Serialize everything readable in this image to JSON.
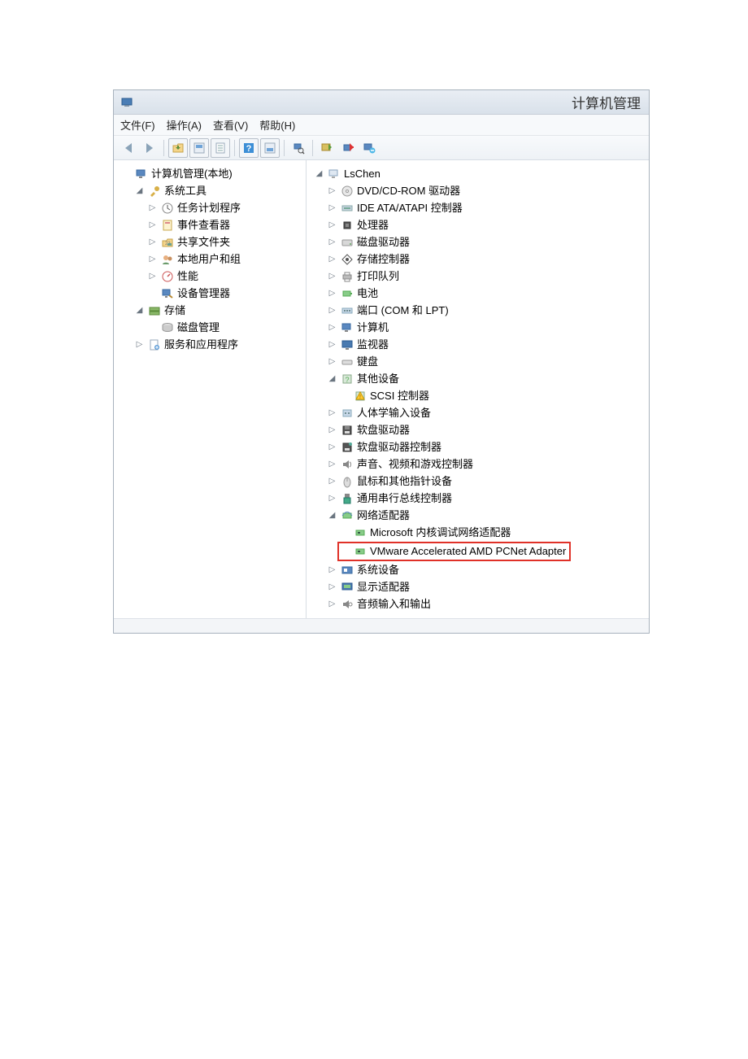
{
  "window": {
    "title": "计算机管理"
  },
  "menu": {
    "file": "文件(F)",
    "action": "操作(A)",
    "view": "查看(V)",
    "help": "帮助(H)"
  },
  "toolbar_icons": [
    "back-icon",
    "forward-icon",
    "sep",
    "up-folder-icon",
    "console-icon",
    "properties-icon",
    "sep",
    "help-icon",
    "console2-icon",
    "sep",
    "find-icon",
    "sep",
    "refresh-icon",
    "update-driver-icon",
    "uninstall-icon"
  ],
  "left_tree": {
    "root": {
      "label": "计算机管理(本地)"
    },
    "system_tools": {
      "label": "系统工具",
      "children": [
        {
          "label": "任务计划程序",
          "icon": "clock"
        },
        {
          "label": "事件查看器",
          "icon": "event"
        },
        {
          "label": "共享文件夹",
          "icon": "share"
        },
        {
          "label": "本地用户和组",
          "icon": "users"
        },
        {
          "label": "性能",
          "icon": "perf"
        },
        {
          "label": "设备管理器",
          "icon": "device",
          "leaf": true
        }
      ]
    },
    "storage": {
      "label": "存储",
      "children": [
        {
          "label": "磁盘管理",
          "icon": "disk",
          "leaf": true
        }
      ]
    },
    "services": {
      "label": "服务和应用程序"
    }
  },
  "right_tree": {
    "root": {
      "label": "LsChen"
    },
    "items": [
      {
        "label": "DVD/CD-ROM 驱动器",
        "icon": "cd"
      },
      {
        "label": "IDE ATA/ATAPI 控制器",
        "icon": "ide"
      },
      {
        "label": "处理器",
        "icon": "cpu"
      },
      {
        "label": "磁盘驱动器",
        "icon": "hdd"
      },
      {
        "label": "存储控制器",
        "icon": "storage"
      },
      {
        "label": "打印队列",
        "icon": "printer"
      },
      {
        "label": "电池",
        "icon": "battery"
      },
      {
        "label": "端口 (COM 和 LPT)",
        "icon": "port"
      },
      {
        "label": "计算机",
        "icon": "computer"
      },
      {
        "label": "监视器",
        "icon": "monitor"
      },
      {
        "label": "键盘",
        "icon": "keyboard"
      },
      {
        "label": "其他设备",
        "icon": "other",
        "expanded": true,
        "children": [
          {
            "label": "SCSI 控制器",
            "icon": "warn"
          }
        ]
      },
      {
        "label": "人体学输入设备",
        "icon": "hid"
      },
      {
        "label": "软盘驱动器",
        "icon": "floppy"
      },
      {
        "label": "软盘驱动器控制器",
        "icon": "floppyctl"
      },
      {
        "label": "声音、视频和游戏控制器",
        "icon": "sound"
      },
      {
        "label": "鼠标和其他指针设备",
        "icon": "mouse"
      },
      {
        "label": "通用串行总线控制器",
        "icon": "usb"
      },
      {
        "label": "网络适配器",
        "icon": "net",
        "expanded": true,
        "children": [
          {
            "label": "Microsoft 内核调试网络适配器",
            "icon": "netcard"
          },
          {
            "label": "VMware Accelerated AMD PCNet Adapter",
            "icon": "netcard",
            "hl": true
          }
        ]
      },
      {
        "label": "系统设备",
        "icon": "system"
      },
      {
        "label": "显示适配器",
        "icon": "display"
      },
      {
        "label": "音频输入和输出",
        "icon": "audio"
      }
    ]
  }
}
